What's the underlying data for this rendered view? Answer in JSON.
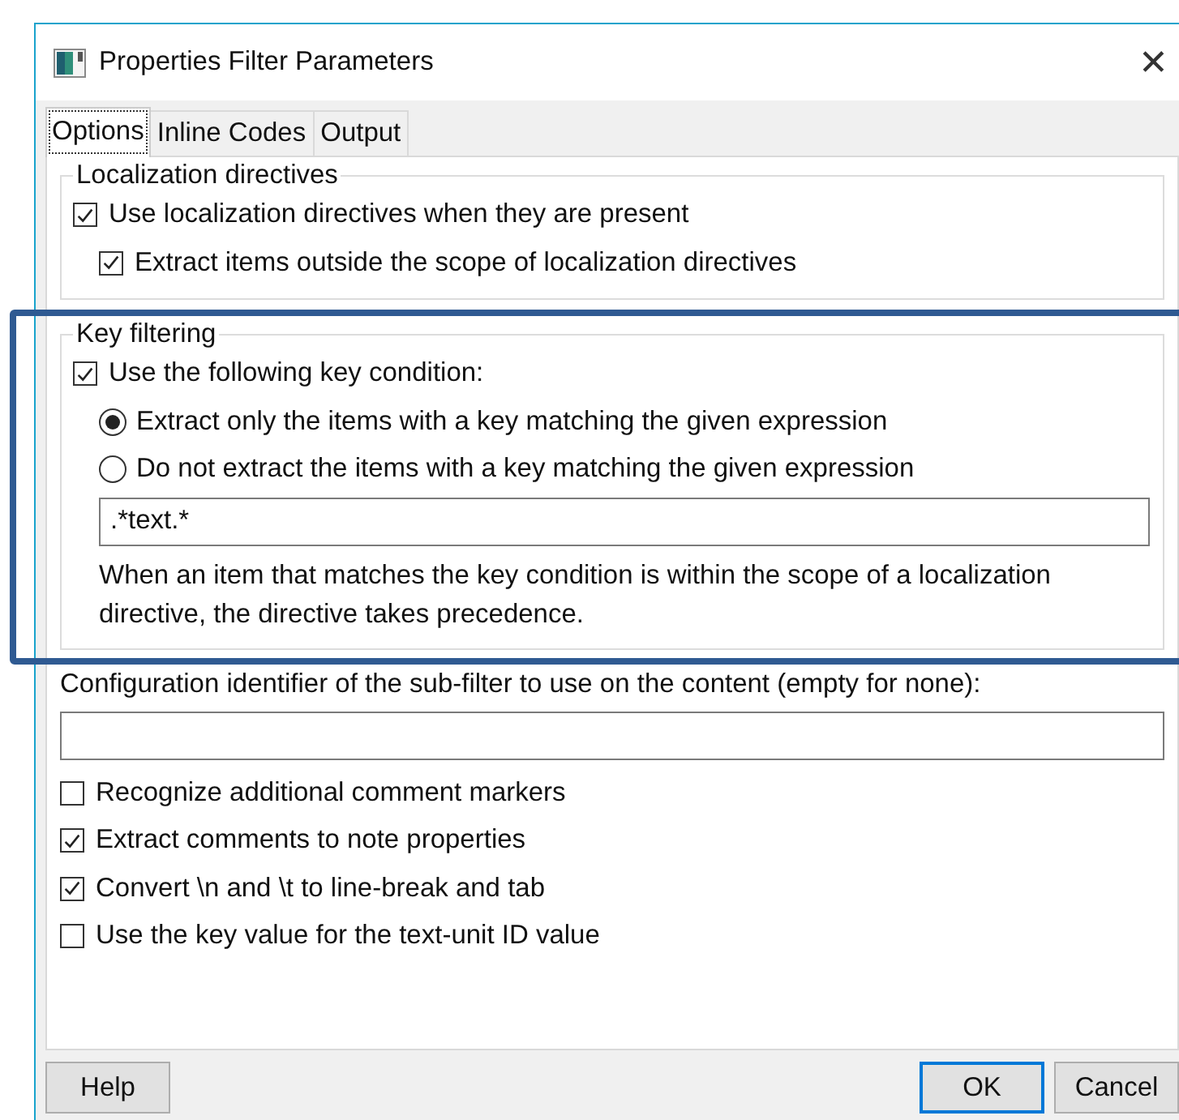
{
  "window": {
    "title": "Properties Filter Parameters",
    "close": "✕"
  },
  "tabs": [
    {
      "label": "Options",
      "selected": true
    },
    {
      "label": "Inline Codes",
      "selected": false
    },
    {
      "label": "Output",
      "selected": false
    }
  ],
  "groups": [
    {
      "title": "Localization directives",
      "highlighted": false,
      "items": [
        {
          "kind": "checkbox",
          "label": "Use localization directives when they are present",
          "checked": true,
          "children": [
            {
              "kind": "checkbox",
              "label": "Extract items outside the scope of localization directives",
              "checked": true
            }
          ]
        }
      ]
    },
    {
      "title": "Key filtering",
      "highlighted": true,
      "items": [
        {
          "kind": "checkbox",
          "label": "Use the following key condition:",
          "checked": true,
          "children": [
            {
              "kind": "radio",
              "label": "Extract only the items with a key matching the given expression",
              "selected": true
            },
            {
              "kind": "radio",
              "label": "Do not extract the items with a key matching the given expression",
              "selected": false
            },
            {
              "kind": "field",
              "value": ".*text.*"
            },
            {
              "kind": "note",
              "text": "When an item that matches the key condition is within the scope of a localization directive, the directive takes precedence."
            }
          ]
        }
      ]
    }
  ],
  "items": [
    {
      "kind": "label",
      "text": "Configuration identifier of the sub-filter to use on the content (empty for none):"
    },
    {
      "kind": "field"
    },
    {
      "kind": "checkbox",
      "label": "Recognize additional comment markers",
      "checked": false
    },
    {
      "kind": "checkbox",
      "label": "Extract comments to note properties",
      "checked": true
    },
    {
      "kind": "checkbox",
      "label": "Convert \\n and \\t to line-break and tab",
      "checked": true
    },
    {
      "kind": "checkbox",
      "label": "Use the key value for the text-unit ID value",
      "checked": false
    }
  ],
  "buttons": [
    {
      "label": "Help",
      "default": false
    },
    {
      "label": "OK",
      "default": true
    },
    {
      "label": "Cancel",
      "default": false
    }
  ]
}
